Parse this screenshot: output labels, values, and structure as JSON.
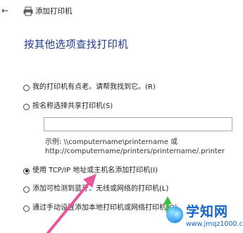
{
  "window": {
    "back_icon": "back-arrow-icon",
    "printer_icon": "printer-icon",
    "title": "添加打印机"
  },
  "main": {
    "heading": "按其他选项查找打印机",
    "options": [
      {
        "label": "我的打印机有点老。请帮我找到它。(R)",
        "checked": false
      },
      {
        "label": "按名称选择共享打印机(S)",
        "checked": false
      },
      {
        "label": "使用 TCP/IP 地址或主机名添加打印机(I)",
        "checked": true
      },
      {
        "label": "添加可检测到蓝牙、无线或网络的打印机(L)",
        "checked": false
      },
      {
        "label": "通过手动设置添加本地打印机或网络打印机(O)",
        "checked": false
      }
    ],
    "shared_name_input": {
      "value": "",
      "placeholder": ""
    },
    "example_line1": "示例: \\\\computername\\printername 或",
    "example_line2": "http://computername/printers/printername/.printer"
  },
  "annotations": {
    "arrow_color": "#e7569c",
    "arrow_color_green": "#3cbf3c"
  },
  "watermark": {
    "name": "学知网",
    "url": "www.jmqz1000.com"
  }
}
